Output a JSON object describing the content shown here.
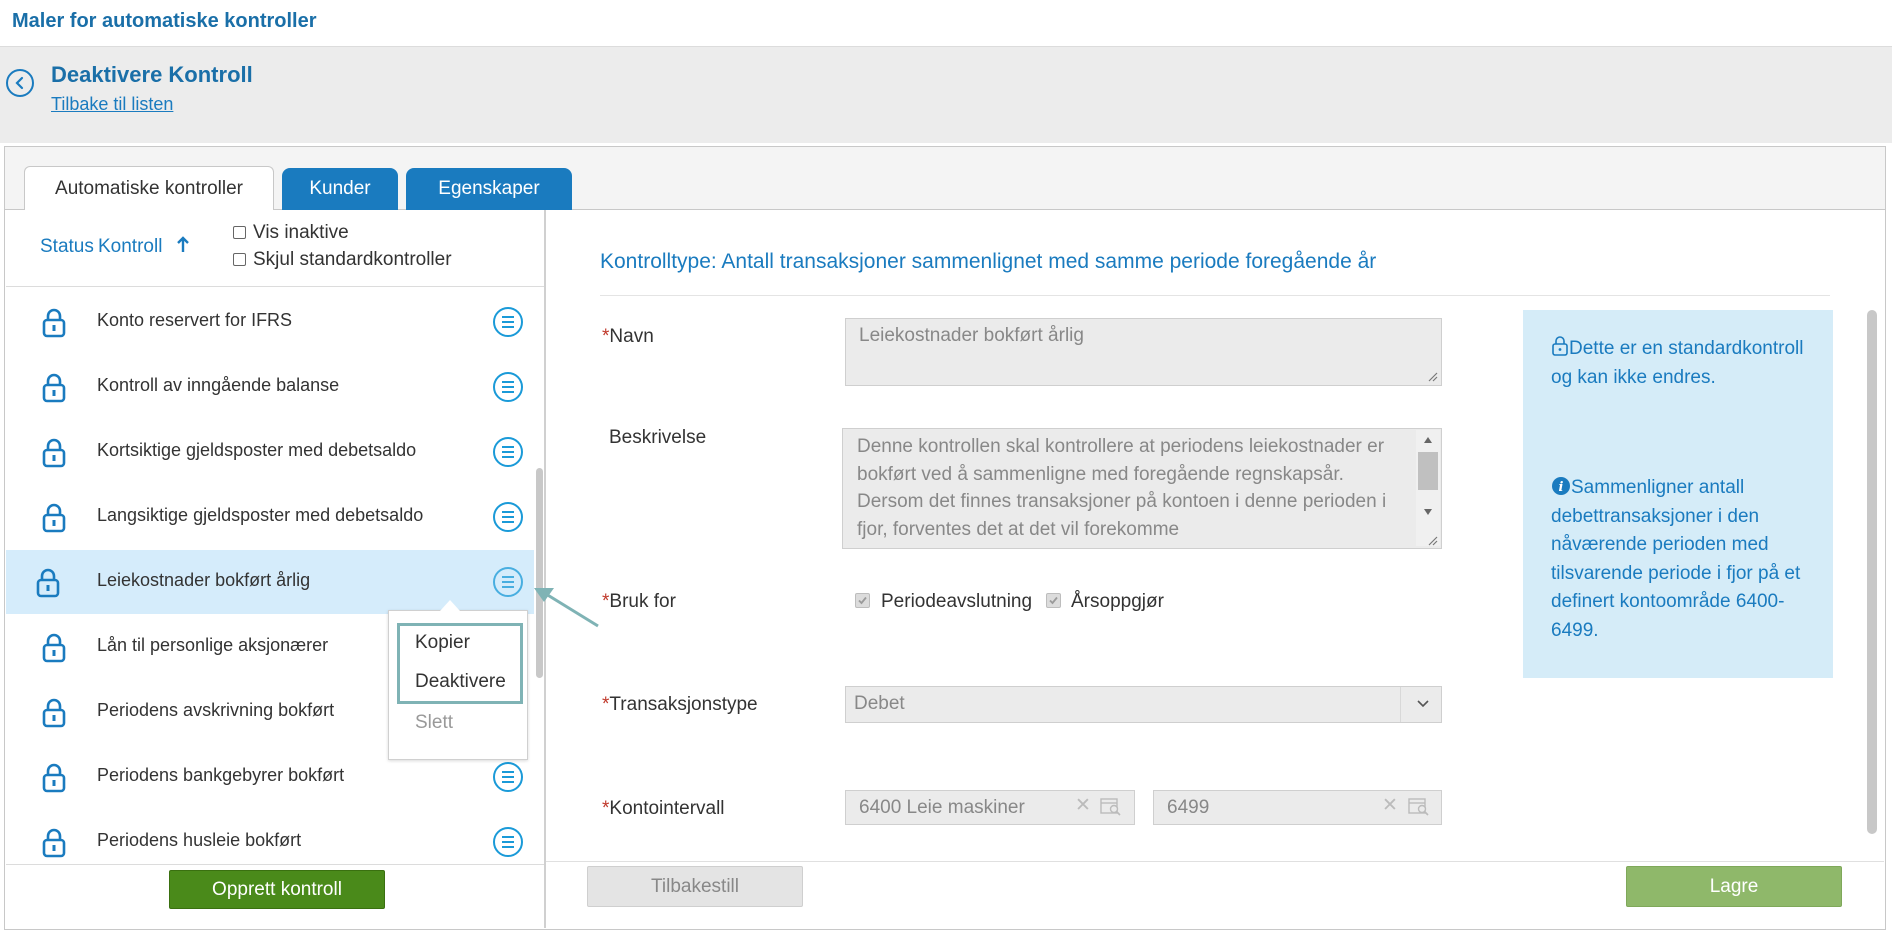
{
  "app": {
    "title": "Maler for automatiske kontroller"
  },
  "header": {
    "title": "Deaktivere Kontroll",
    "back_link": "Tilbake til listen"
  },
  "tabs": [
    {
      "label": "Automatiske kontroller",
      "active": true
    },
    {
      "label": "Kunder",
      "active": false
    },
    {
      "label": "Egenskaper",
      "active": false
    }
  ],
  "list": {
    "col_status": "Status",
    "col_kontroll": "Kontroll",
    "sort_icon": "arrow-up-icon",
    "vis_inaktive": "Vis inaktive",
    "skjul_standard": "Skjul standardkontroller",
    "items": [
      {
        "label": "Konto reservert for IFRS",
        "icon": "lock-icon"
      },
      {
        "label": "Kontroll av inngående balanse",
        "icon": "lock-icon"
      },
      {
        "label": "Kortsiktige gjeldsposter med debetsaldo",
        "icon": "lock-icon"
      },
      {
        "label": "Langsiktige gjeldsposter med debetsaldo",
        "icon": "lock-icon"
      },
      {
        "label": "Leiekostnader bokført årlig",
        "icon": "lock-icon",
        "selected": true
      },
      {
        "label": "Lån til personlige aksjonærer",
        "icon": "lock-icon"
      },
      {
        "label": "Periodens avskrivning bokført",
        "icon": "lock-icon"
      },
      {
        "label": "Periodens bankgebyrer bokført",
        "icon": "lock-icon"
      },
      {
        "label": "Periodens husleie bokført",
        "icon": "lock-icon"
      }
    ],
    "create_button": "Opprett kontroll"
  },
  "context_menu": {
    "kopier": "Kopier",
    "deaktivere": "Deaktivere",
    "slett": "Slett"
  },
  "form": {
    "kontrolltype": "Kontrolltype: Antall transaksjoner sammenlignet med samme periode foregående år",
    "required_mark": "*",
    "navn_label": "Navn",
    "navn_value": "Leiekostnader bokført årlig",
    "beskrivelse_label": "Beskrivelse",
    "beskrivelse_value": "Denne kontrollen skal kontrollere at periodens leiekostnader er bokført ved å sammenligne med foregående regnskapsår. Dersom det finnes transaksjoner på kontoen i denne perioden i fjor, forventes det at det vil forekomme",
    "bruk_for_label": "Bruk for",
    "periodeavslutning": "Periodeavslutning",
    "aarsoppgjor": "Årsoppgjør",
    "transaksjonstype_label": "Transaksjonstype",
    "transaksjonstype_value": "Debet",
    "kontointervall_label": "Kontointervall",
    "konto_fra": "6400 Leie maskiner",
    "konto_til": "6499"
  },
  "info": {
    "standard_text": "Dette er en standardkontroll og kan ikke endres.",
    "desc_text": "Sammenligner antall debettransaksjoner i den nåværende perioden med tilsvarende periode i fjor på et definert kontoområde 6400-6499."
  },
  "footer": {
    "reset": "Tilbakestill",
    "save": "Lagre"
  },
  "colors": {
    "accent": "#1a7bbf",
    "create": "#4a8a1a",
    "save": "#8fb86a",
    "info_bg": "#d5ecf8",
    "selected_row": "#d5ecfb"
  }
}
